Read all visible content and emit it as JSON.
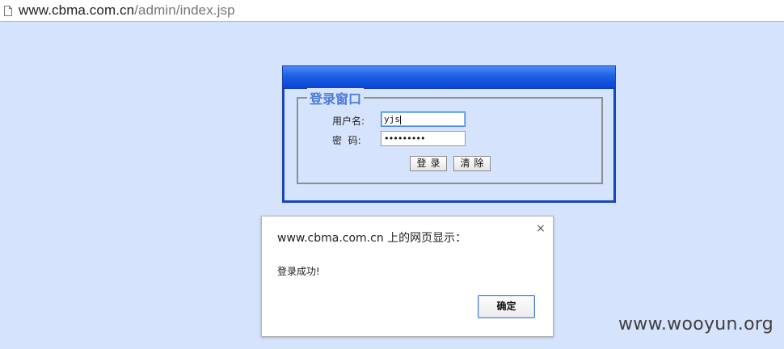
{
  "browser": {
    "url_host": "www.cbma.com.cn",
    "url_path": "/admin/index.jsp",
    "page_icon": "document-icon"
  },
  "login": {
    "legend": "登录窗口",
    "username_label": "用户名:",
    "password_label": "密  码:",
    "username_value": "yjs",
    "password_value": "•••••••••",
    "login_button": "登录",
    "clear_button": "清除"
  },
  "alert": {
    "title": "www.cbma.com.cn 上的网页显示：",
    "close": "×",
    "message": "登录成功!",
    "ok_button": "确定"
  },
  "watermark": "www.wooyun.org",
  "colors": {
    "page_background": "#d6e3fd",
    "titlebar_blue": "#1d5fe6",
    "legend_blue": "#4a7bd8"
  }
}
